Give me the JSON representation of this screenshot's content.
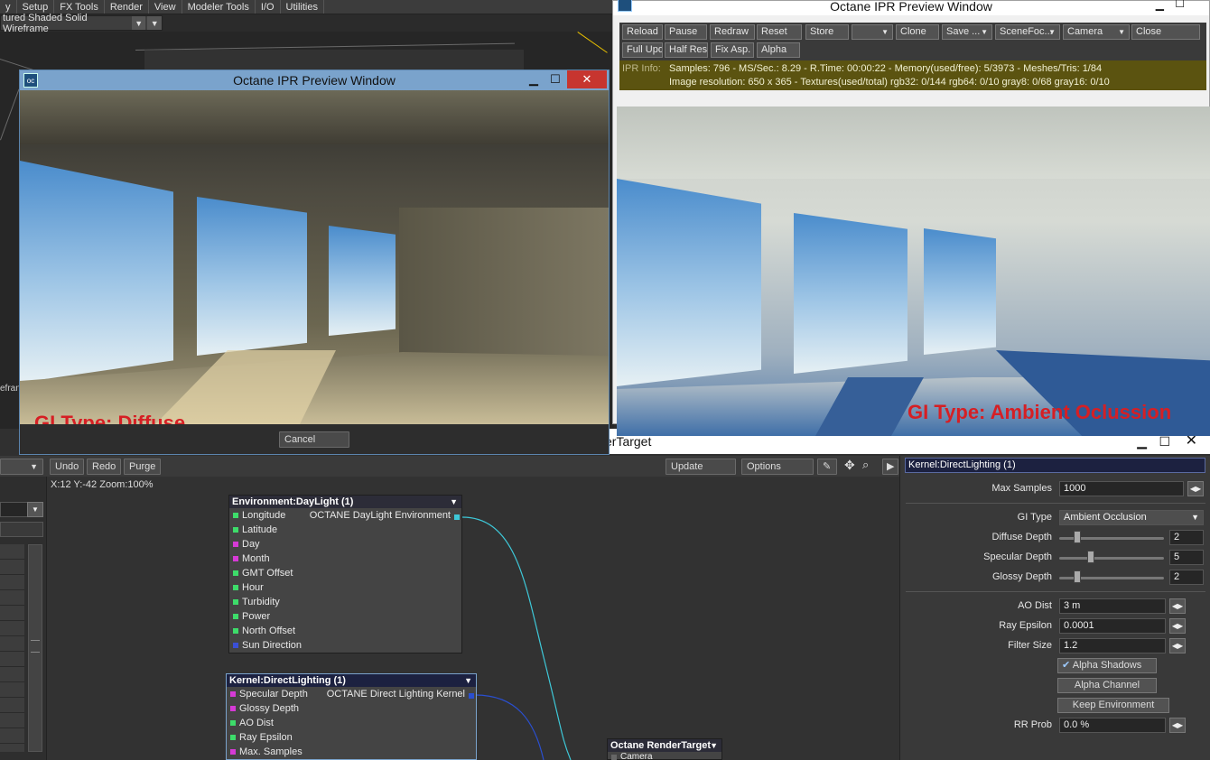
{
  "menubar": {
    "items": [
      "y",
      "Setup",
      "FX Tools",
      "Render",
      "View",
      "Modeler Tools",
      "I/O",
      "Utilities"
    ]
  },
  "viewport": {
    "display_mode": "tured Shaded Solid Wireframe",
    "side_label": "efran"
  },
  "left_window": {
    "title": "Octane IPR Preview Window",
    "overlay_label": "GI Type: Diffuse",
    "cancel": "Cancel"
  },
  "right_window": {
    "title": "Octane IPR Preview Window",
    "toolbar_row1": [
      "Reload",
      "Pause",
      "Redraw",
      "Reset",
      "Store",
      "",
      "Clone",
      "Save ...",
      "SceneFoc...",
      "Camera",
      "Close"
    ],
    "toolbar_row2": [
      "Full Upd.",
      "Half Res",
      "Fix Asp.",
      "Alpha"
    ],
    "ipr_label": "IPR Info:",
    "ipr_line1": "Samples: 796  -  MS/Sec.: 8.29  -  R.Time: 00:00:22 - Memory(used/free): 5/3973  -  Meshes/Tris: 1/84",
    "ipr_line2": "Image resolution: 650 x 365 - Textures(used/total) rgb32: 0/144   rgb64: 0/10   gray8: 0/68   gray16: 0/10",
    "overlay_label": "GI Type: Ambient Oclussion"
  },
  "node_editor": {
    "title": "erTarget",
    "toolbar": {
      "undo": "Undo",
      "redo": "Redo",
      "purge": "Purge",
      "update": "Update",
      "options": "Options"
    },
    "coords": "X:12 Y:-42 Zoom:100%",
    "nodes": {
      "daylight": {
        "title": "Environment:DayLight (1)",
        "output": "OCTANE DayLight Environment",
        "inputs": [
          "Longitude",
          "Latitude",
          "Day",
          "Month",
          "GMT Offset",
          "Hour",
          "Turbidity",
          "Power",
          "North Offset",
          "Sun Direction"
        ],
        "colors": [
          "#3ddc6a",
          "#3ddc6a",
          "#d63ad6",
          "#d63ad6",
          "#3ddc6a",
          "#3ddc6a",
          "#3ddc6a",
          "#3ddc6a",
          "#3ddc6a",
          "#3a4fd6"
        ]
      },
      "kernel": {
        "title": "Kernel:DirectLighting (1)",
        "output": "OCTANE Direct Lighting Kernel",
        "inputs": [
          "Specular Depth",
          "Glossy Depth",
          "AO Dist",
          "Ray Epsilon",
          "Max. Samples"
        ],
        "colors": [
          "#d63ad6",
          "#d63ad6",
          "#3ddc6a",
          "#3ddc6a",
          "#d63ad6"
        ]
      },
      "rendertarget": {
        "title": "Octane RenderTarget",
        "input": "Camera"
      }
    }
  },
  "properties": {
    "header": "Kernel:DirectLighting (1)",
    "max_samples": {
      "label": "Max Samples",
      "value": "1000"
    },
    "gi_type": {
      "label": "GI Type",
      "value": "Ambient Occlusion"
    },
    "diffuse_depth": {
      "label": "Diffuse Depth",
      "value": "2",
      "level": 0.14
    },
    "specular_depth": {
      "label": "Specular Depth",
      "value": "5",
      "level": 0.28
    },
    "glossy_depth": {
      "label": "Glossy Depth",
      "value": "2",
      "level": 0.14
    },
    "ao_dist": {
      "label": "AO Dist",
      "value": "3 m"
    },
    "ray_epsilon": {
      "label": "Ray Epsilon",
      "value": "0.0001"
    },
    "filter_size": {
      "label": "Filter Size",
      "value": "1.2"
    },
    "alpha_shadows": {
      "label": "Alpha Shadows",
      "checked": true
    },
    "alpha_channel": {
      "label": "Alpha Channel",
      "checked": false
    },
    "keep_environment": {
      "label": "Keep Environment",
      "checked": false
    },
    "rr_prob": {
      "label": "RR Prob",
      "value": "0.0 %"
    }
  }
}
